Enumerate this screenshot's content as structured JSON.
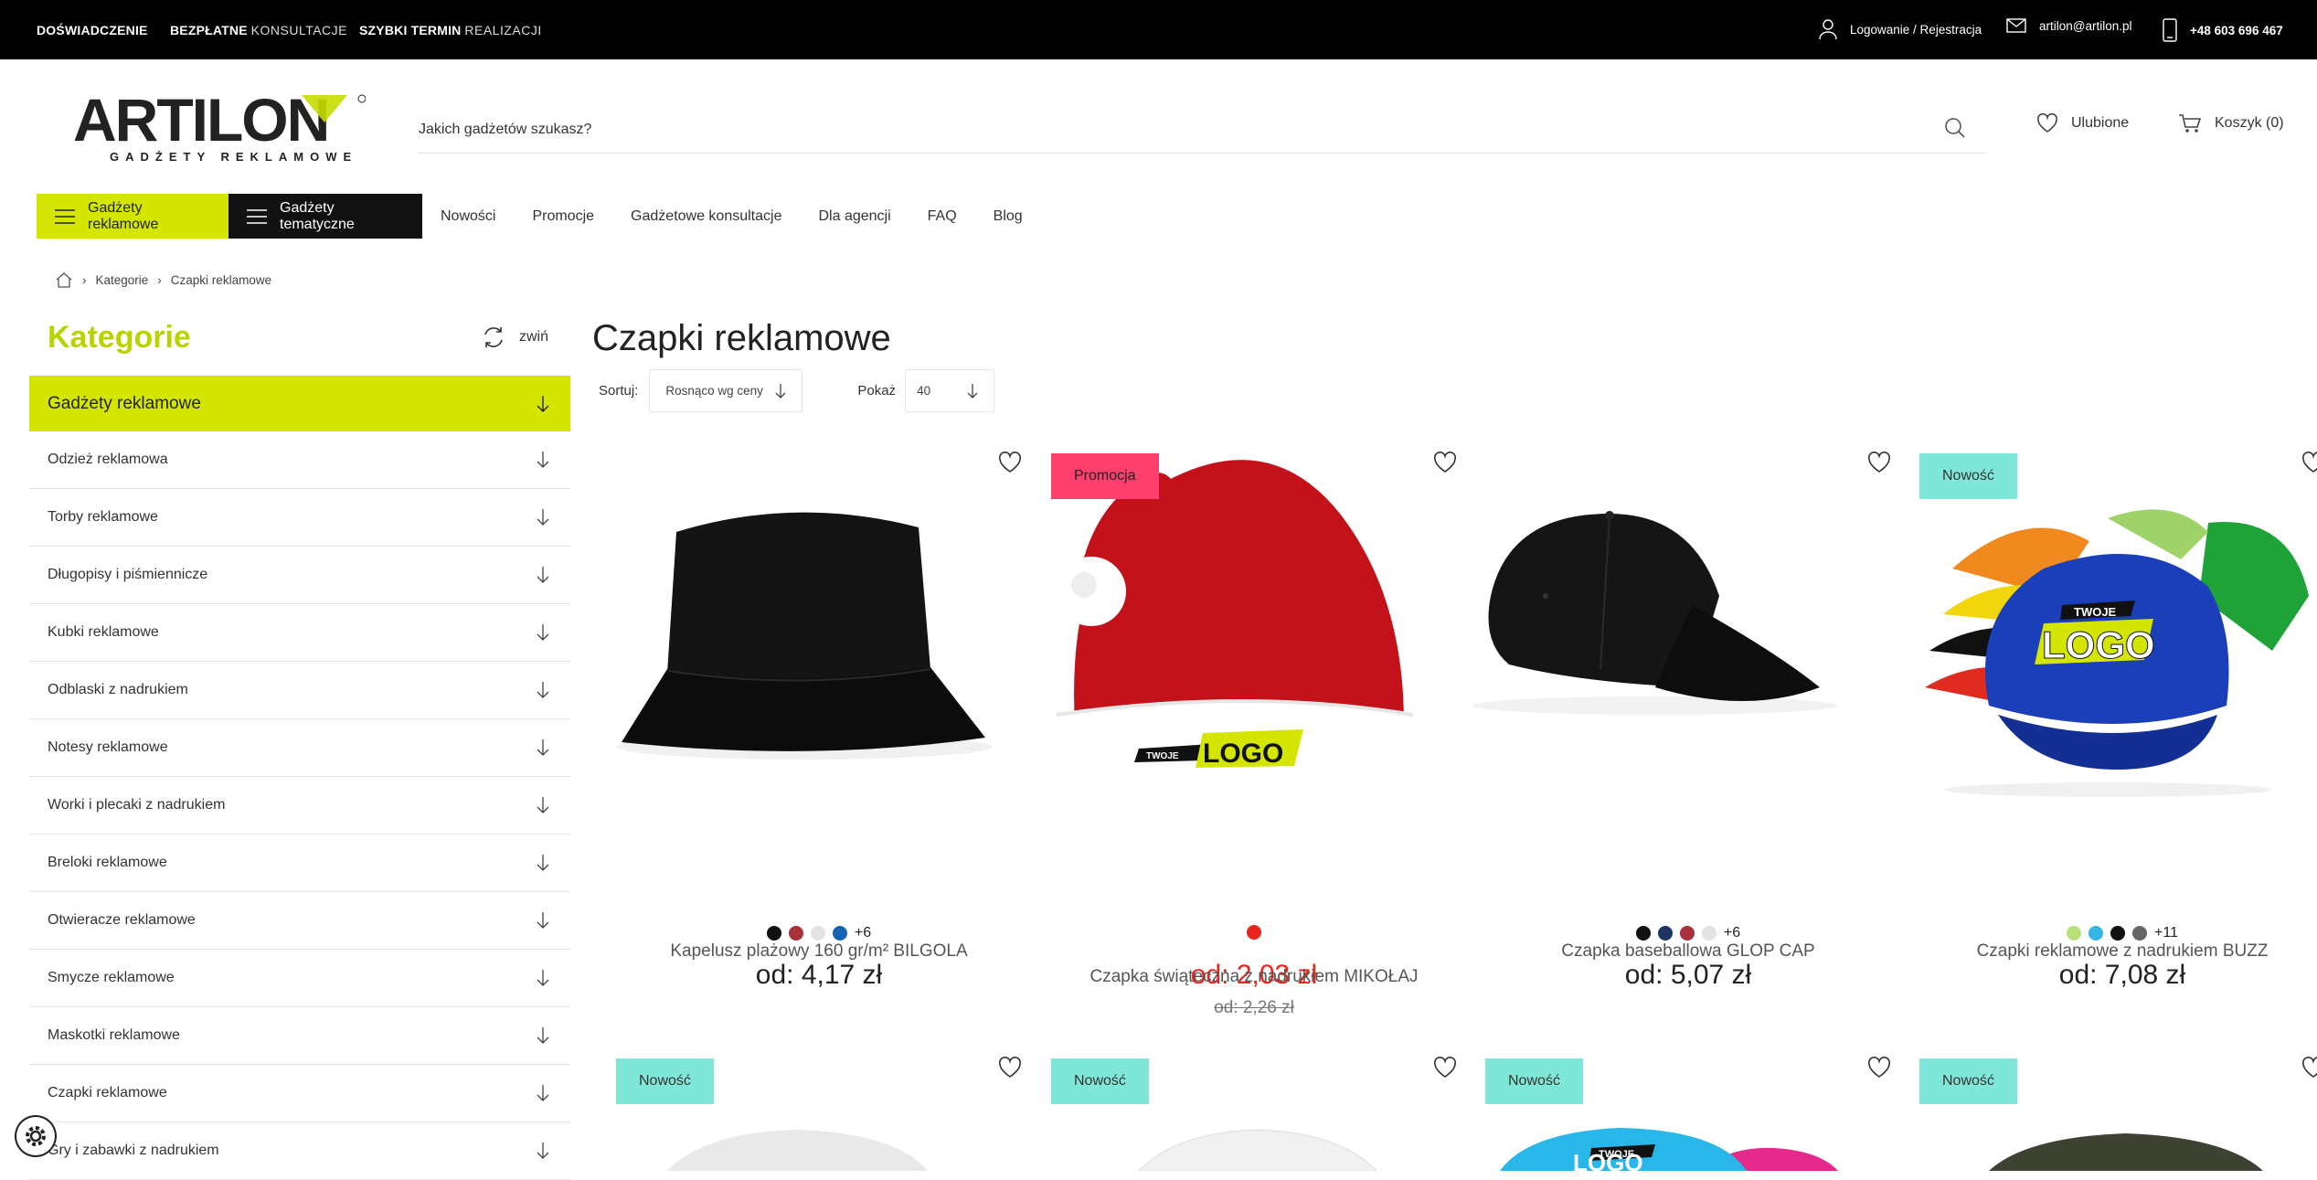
{
  "topbar": {
    "promos": [
      {
        "bold": "DOŚWIADCZENIE",
        "light": ""
      },
      {
        "bold": "BEZPŁATNE",
        "light": "KONSULTACJE"
      },
      {
        "bold": "SZYBKI TERMIN",
        "light": "REALIZACJI"
      }
    ],
    "login": "Logowanie / Rejestracja",
    "email": "artilon@artilon.pl",
    "phone": "+48 603 696 467"
  },
  "logo": {
    "word": "ARTILON",
    "sub": "GADŻETY REKLAMOWE"
  },
  "search": {
    "placeholder": "Jakich gadżetów szukasz?"
  },
  "header": {
    "favorites": "Ulubione",
    "cart": "Koszyk (0)"
  },
  "nav": {
    "btn_gadgets": "Gadżety reklamowe",
    "btn_thematic": "Gadżety tematyczne",
    "links": [
      "Nowości",
      "Promocje",
      "Gadżetowe konsultacje",
      "Dla agencji",
      "FAQ",
      "Blog"
    ]
  },
  "breadcrumb": [
    "Kategorie",
    "Czapki reklamowe"
  ],
  "sidebar": {
    "title": "Kategorie",
    "collapse": "zwiń",
    "active": "Gadżety reklamowe",
    "items": [
      "Odzież reklamowa",
      "Torby reklamowe",
      "Długopisy i piśmiennicze",
      "Kubki reklamowe",
      "Odblaski z nadrukiem",
      "Notesy reklamowe",
      "Worki i plecaki z nadrukiem",
      "Breloki reklamowe",
      "Otwieracze reklamowe",
      "Smycze reklamowe",
      "Maskotki reklamowe",
      "Czapki reklamowe",
      "Gry i zabawki z nadrukiem"
    ]
  },
  "main": {
    "title": "Czapki reklamowe",
    "sort_label": "Sortuj:",
    "sort_value": "Rosnąco wg ceny",
    "show_label": "Pokaż",
    "show_value": "40"
  },
  "products": [
    {
      "name": "Kapelusz plażowy 160 gr/m² BILGOLA",
      "price": "od: 4,17 zł",
      "old": "",
      "badge": "",
      "colors": [
        "#111111",
        "#a8313b",
        "#e3e3e3",
        "#1764b5"
      ],
      "more": "+6"
    },
    {
      "name": "Czapka świąteczna z nadrukiem MIKOŁAJ",
      "price": "od: 2,03 zł",
      "old": "od: 2,26 zł",
      "badge": "Promocja",
      "colors": [
        "#e8251c"
      ],
      "more": ""
    },
    {
      "name": "Czapka baseballowa GLOP CAP",
      "price": "od: 5,07 zł",
      "old": "",
      "badge": "",
      "colors": [
        "#111111",
        "#1e3564",
        "#a8313b",
        "#e3e3e3"
      ],
      "more": "+6"
    },
    {
      "name": "Czapki reklamowe z nadrukiem BUZZ",
      "price": "od: 7,08 zł",
      "old": "",
      "badge": "Nowość",
      "colors": [
        "#b9e07a",
        "#35b5e5",
        "#111111",
        "#666666"
      ],
      "more": "+11"
    }
  ],
  "products_row2_badges": [
    "Nowość",
    "Nowość",
    "Nowość",
    "Nowość"
  ],
  "logo_print": {
    "small": "TWOJE",
    "big": "LOGO"
  }
}
